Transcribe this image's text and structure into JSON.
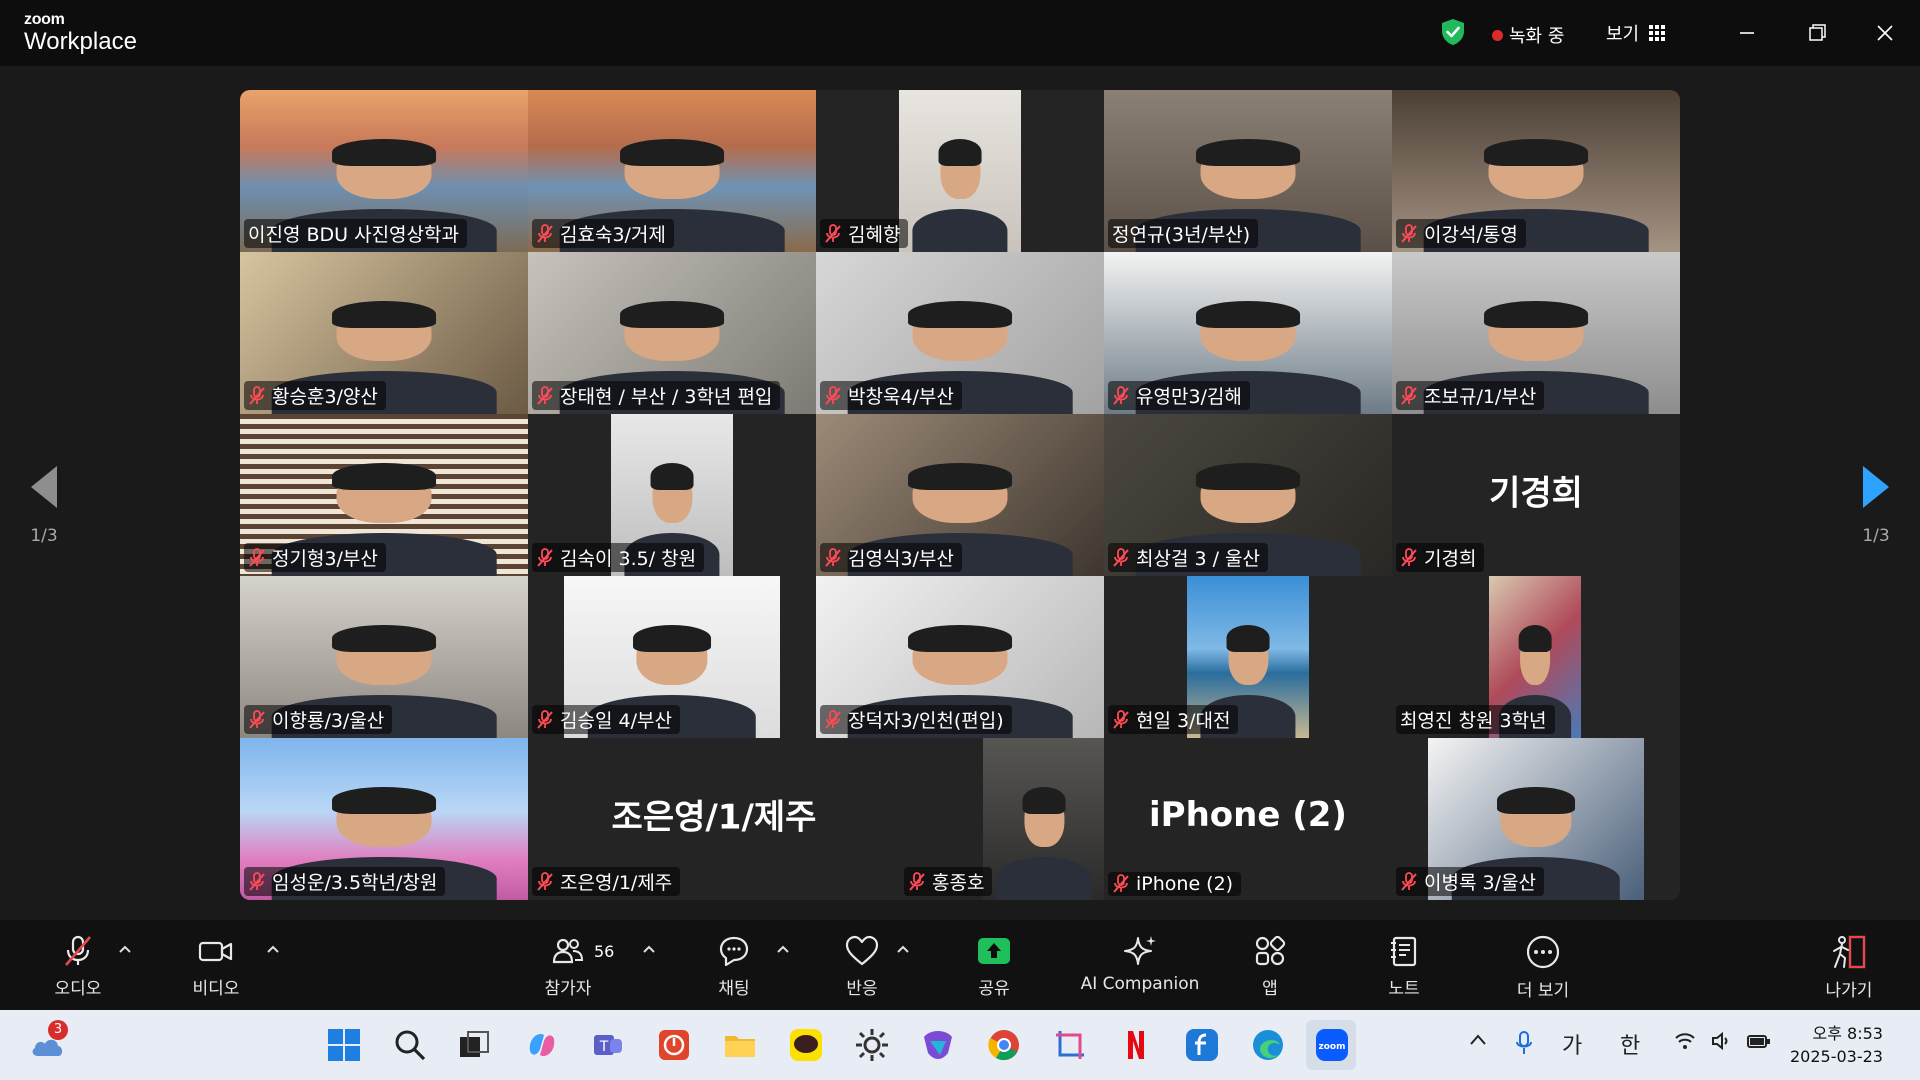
{
  "app": {
    "brand_top": "zoom",
    "brand_bottom": "Workplace"
  },
  "titlebar": {
    "recording": "녹화 중",
    "view": "보기"
  },
  "pager": {
    "prev_page": "1/3",
    "next_page": "1/3"
  },
  "participants": [
    {
      "name": "이진영 BDU 사진영상학과",
      "muted": false
    },
    {
      "name": "김효숙3/거제",
      "muted": true
    },
    {
      "name": "김혜향",
      "muted": true
    },
    {
      "name": "정연규(3년/부산)",
      "muted": false,
      "active_speaker": true
    },
    {
      "name": "이강석/통영",
      "muted": true
    },
    {
      "name": "황승훈3/양산",
      "muted": true
    },
    {
      "name": "장태현 / 부산 / 3학년 편입",
      "muted": true
    },
    {
      "name": "박창욱4/부산",
      "muted": true
    },
    {
      "name": "유영만3/김해",
      "muted": true
    },
    {
      "name": "조보규/1/부산",
      "muted": true
    },
    {
      "name": "정기형3/부산",
      "muted": true
    },
    {
      "name": "김숙이 3.5/ 창원",
      "muted": true
    },
    {
      "name": "김영식3/부산",
      "muted": true
    },
    {
      "name": "최상걸 3 / 울산",
      "muted": true
    },
    {
      "name": "기경희",
      "muted": true,
      "video_off": true
    },
    {
      "name": "이향룡/3/울산",
      "muted": true
    },
    {
      "name": "김승일 4/부산",
      "muted": true
    },
    {
      "name": "장덕자3/인천(편입)",
      "muted": true
    },
    {
      "name": "현일 3/대전",
      "muted": true
    },
    {
      "name": "최영진 창원 3학년",
      "muted": false
    },
    {
      "name": "임성운/3.5학년/창원",
      "muted": true
    },
    {
      "name": "조은영/1/제주",
      "muted": true,
      "video_off": true
    },
    {
      "name": "홍종호",
      "muted": true
    },
    {
      "name": "iPhone (2)",
      "muted": true,
      "video_off": true
    },
    {
      "name": "이병록 3/울산",
      "muted": true
    }
  ],
  "toolbar": {
    "audio": "오디오",
    "video": "비디오",
    "participants": "참가자",
    "participants_count": "56",
    "chat": "채팅",
    "reactions": "반응",
    "share": "공유",
    "ai_companion": "AI Companion",
    "apps": "앱",
    "notes": "노트",
    "more": "더 보기",
    "leave": "나가기"
  },
  "taskbar": {
    "weather_badge": "3",
    "ime_1": "가",
    "ime_2": "한",
    "time": "오후 8:53",
    "date": "2025-03-23"
  },
  "colors": {
    "active_speaker": "#2fd39a",
    "share_green": "#1fbf5b",
    "next_arrow": "#2da3ff",
    "leave_red": "#e5484d"
  }
}
